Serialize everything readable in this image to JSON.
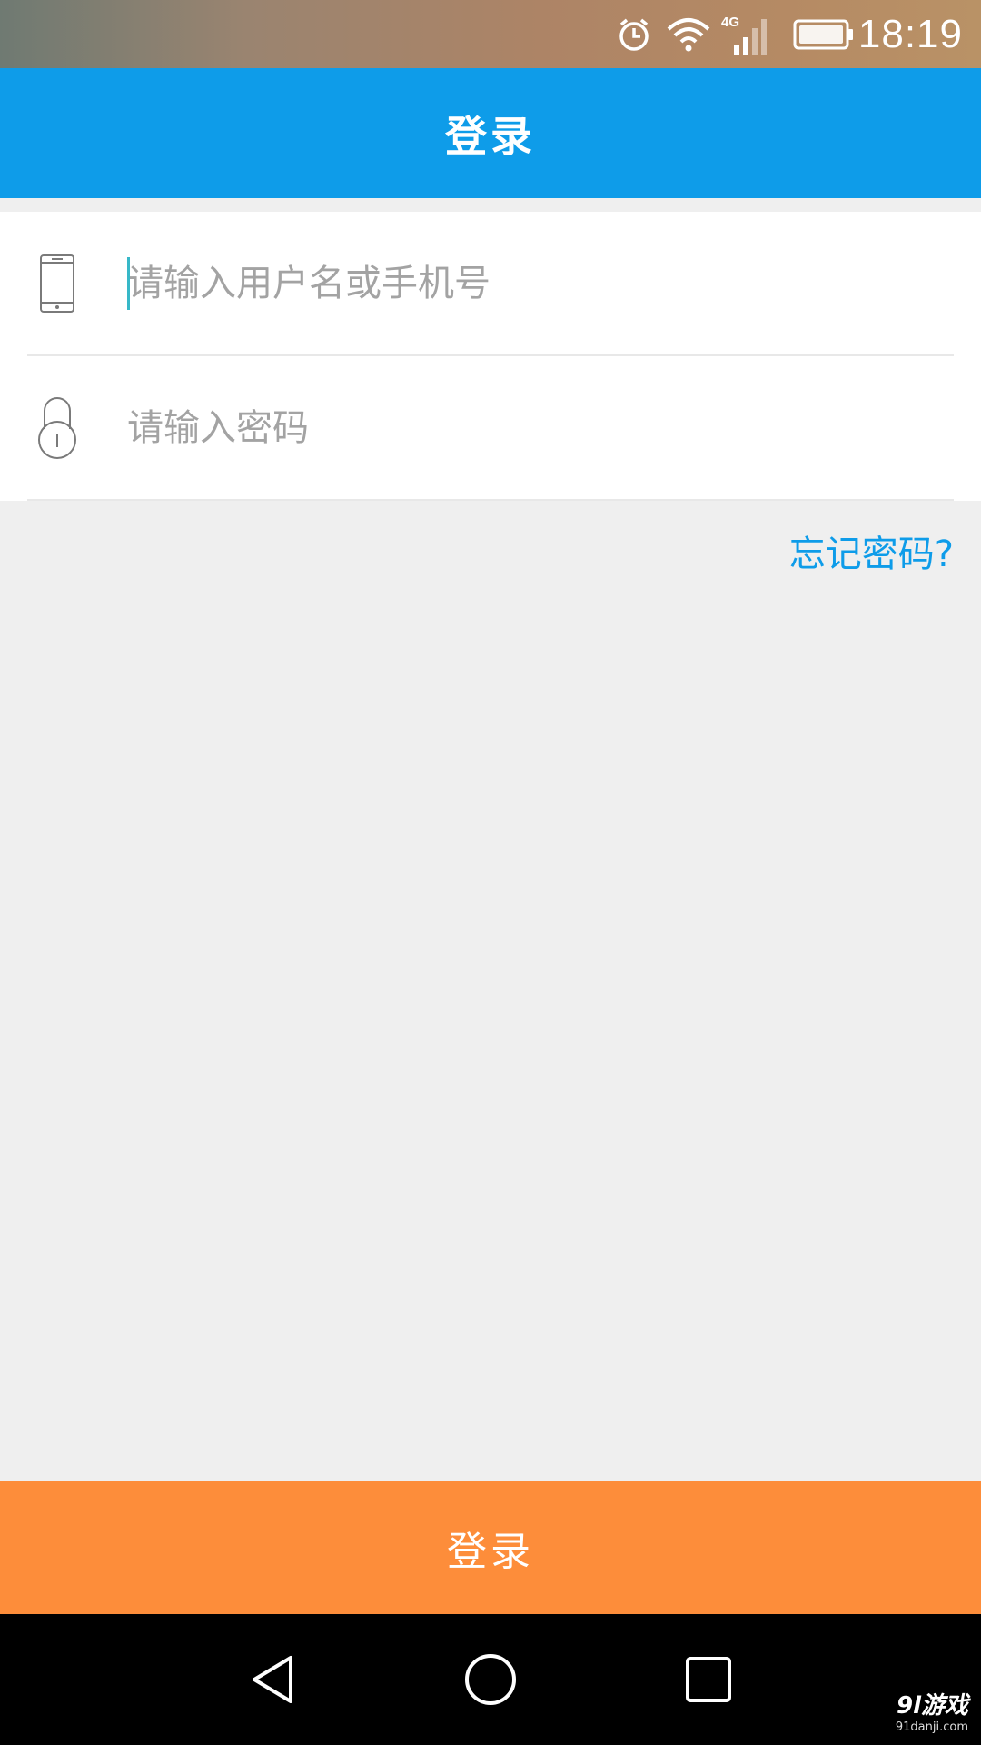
{
  "status_bar": {
    "time": "18:19",
    "network_type": "4G",
    "icons": [
      "alarm-icon",
      "wifi-icon",
      "signal-icon",
      "battery-icon"
    ]
  },
  "header": {
    "title": "登录"
  },
  "form": {
    "username": {
      "icon": "phone-icon",
      "placeholder": "请输入用户名或手机号",
      "value": ""
    },
    "password": {
      "icon": "lock-icon",
      "placeholder": "请输入密码",
      "value": ""
    },
    "forgot_password_label": "忘记密码?"
  },
  "login_button_label": "登录",
  "nav_bar": {
    "icons": [
      "back-icon",
      "home-icon",
      "recents-icon"
    ]
  },
  "watermark": {
    "logo": "9l游戏",
    "url": "91danji.com"
  },
  "colors": {
    "primary": "#0e9ce9",
    "login_button": "#fd8d3a",
    "background": "#efefef",
    "placeholder": "#a3a3a3"
  }
}
